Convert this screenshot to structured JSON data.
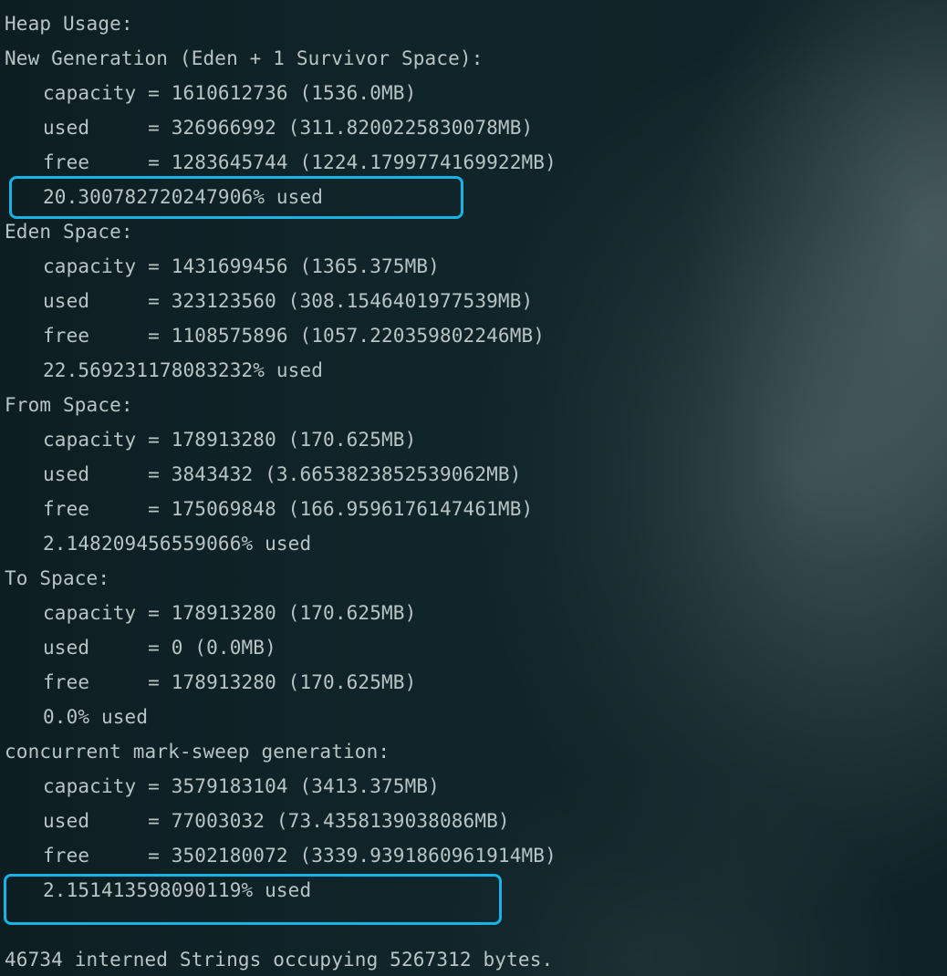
{
  "terminal": {
    "heap_usage": "Heap Usage:",
    "new_gen": {
      "header": "New Generation (Eden + 1 Survivor Space):",
      "capacity": "capacity = 1610612736 (1536.0MB)",
      "used": "used     = 326966992 (311.8200225830078MB)",
      "free": "free     = 1283645744 (1224.1799774169922MB)",
      "pct": "20.300782720247906% used"
    },
    "eden": {
      "header": "Eden Space:",
      "capacity": "capacity = 1431699456 (1365.375MB)",
      "used": "used     = 323123560 (308.1546401977539MB)",
      "free": "free     = 1108575896 (1057.220359802246MB)",
      "pct": "22.569231178083232% used"
    },
    "from": {
      "header": "From Space:",
      "capacity": "capacity = 178913280 (170.625MB)",
      "used": "used     = 3843432 (3.6653823852539062MB)",
      "free": "free     = 175069848 (166.9596176147461MB)",
      "pct": "2.148209456559066% used"
    },
    "to": {
      "header": "To Space:",
      "capacity": "capacity = 178913280 (170.625MB)",
      "used": "used     = 0 (0.0MB)",
      "free": "free     = 178913280 (170.625MB)",
      "pct": "0.0% used"
    },
    "cms": {
      "header": "concurrent mark-sweep generation:",
      "capacity": "capacity = 3579183104 (3413.375MB)",
      "used": "used     = 77003032 (73.4358139038086MB)",
      "free": "free     = 3502180072 (3339.9391860961914MB)",
      "pct": "2.151413598090119% used"
    },
    "interned": "46734 interned Strings occupying 5267312 bytes."
  },
  "highlight_color": "#17b3e6",
  "text_color": "#b9c4c4",
  "background_color": "#0f2227"
}
